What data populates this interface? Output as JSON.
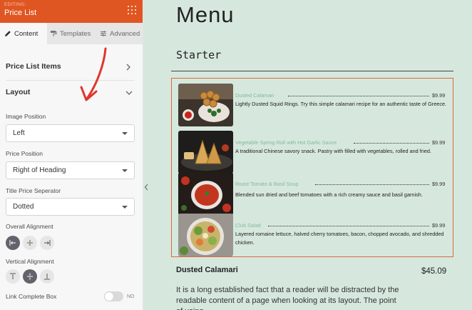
{
  "panel": {
    "editing_label": "EDITING:",
    "title": "Price List",
    "tabs": [
      {
        "label": "Content",
        "icon": "pencil-icon"
      },
      {
        "label": "Templates",
        "icon": "paint-roller-icon"
      },
      {
        "label": "Advanced",
        "icon": "sliders-icon"
      }
    ],
    "sections": {
      "items_title": "Price List Items",
      "layout_title": "Layout"
    },
    "fields": {
      "image_position_label": "Image Position",
      "image_position_value": "Left",
      "price_position_label": "Price Position",
      "price_position_value": "Right of Heading",
      "separator_label": "Title Price Seperator",
      "separator_value": "Dotted",
      "overall_alignment_label": "Overall Alignment",
      "vertical_alignment_label": "Vertical Alignment",
      "link_box_label": "Link Complete Box",
      "link_box_toggle": "NO"
    },
    "accent_color": "#e05622"
  },
  "preview": {
    "menu_title": "Menu",
    "section_title": "Starter",
    "items": [
      {
        "name": "Dusted Calamari",
        "price": "$9.99",
        "description": "Lightly Dusted Squid Rings. Try this simple calamari recipe for an authentic taste of Greece.",
        "image_icon": "calamari-photo"
      },
      {
        "name": "Vegetable Spring Roll with Hot Garlic Sauce",
        "price": "$9.99",
        "description": "A traditional Chinese savory snack. Pastry with filled with vegetables, rolled and fried.",
        "image_icon": "spring-roll-photo"
      },
      {
        "name": "Roast Tomato & Basil Soup",
        "price": "$9.99",
        "description": "Blended sun dried and beef tomatoes with a rich creamy sauce and basil garnish.",
        "image_icon": "tomato-soup-photo"
      },
      {
        "name": "Club Salad",
        "price": "$9.99",
        "description": "Layered romaine lettuce, halved cherry tomatoes, bacon, chopped avocado, and shredded chicken.",
        "image_icon": "salad-photo"
      }
    ],
    "detail": {
      "name": "Dusted Calamari",
      "price": "$45.09",
      "text": "It is a long established fact that a reader will be distracted by the readable content of a page when looking at its layout. The point of using"
    },
    "background_color": "#d6e8dd",
    "item_name_color": "#84b89a",
    "box_border_color": "#d9693c"
  }
}
